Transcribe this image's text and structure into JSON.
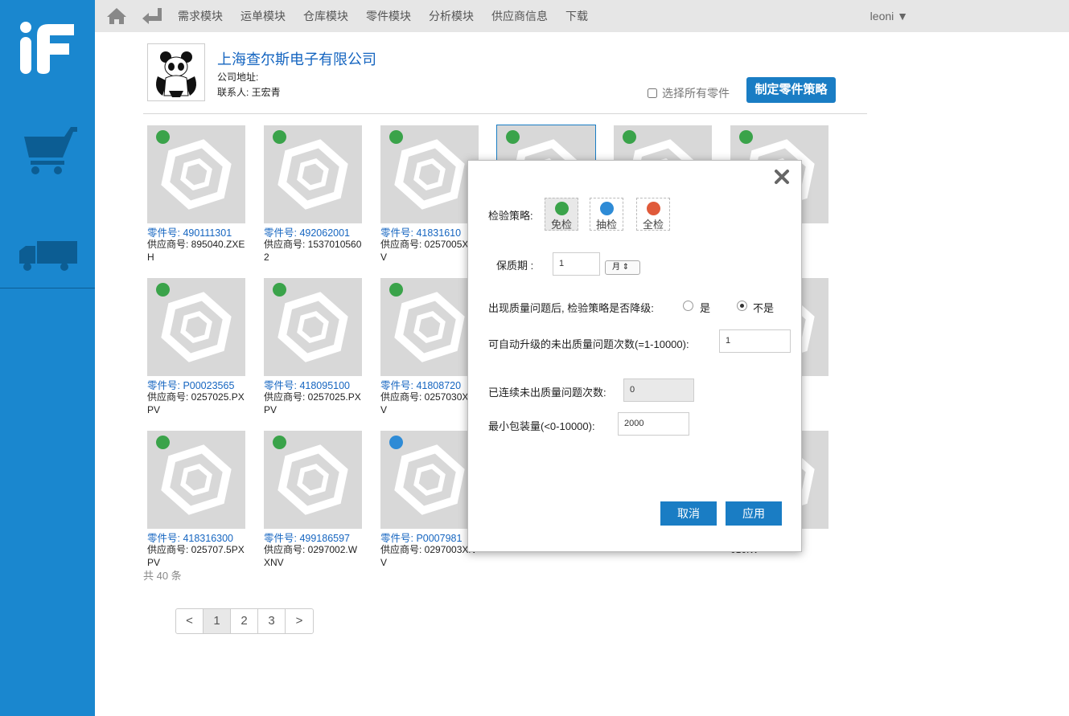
{
  "sidebar": {
    "logo_text": "iF",
    "icons": [
      "shopping-cart-icon",
      "truck-icon"
    ]
  },
  "topbar": {
    "nav": [
      "需求模块",
      "运单模块",
      "仓库模块",
      "零件模块",
      "分析模块",
      "供应商信息",
      "下载"
    ],
    "user": "leoni ▼"
  },
  "company": {
    "name": "上海查尔斯电子有限公司",
    "address_label": "公司地址:",
    "contact": "联系人:  王宏青",
    "select_all": "选择所有零件",
    "strategy_button": "制定零件策略"
  },
  "parts": [
    {
      "part": "零件号:  490111301",
      "supplier": "供应商号:  895040.ZXEH",
      "badge": "tag"
    },
    {
      "part": "零件号:  492062001",
      "supplier": "供应商号:  15370105602",
      "badge": "tag"
    },
    {
      "part": "零件号:  41831610",
      "supplier": "供应商号:  0257005XPV",
      "badge": "tag"
    },
    {
      "part": "",
      "supplier": "",
      "badge": "tag"
    },
    {
      "part": "",
      "supplier": "",
      "badge": "tag"
    },
    {
      "part": "7201",
      "supplier": "020.P",
      "badge": "tag"
    },
    {
      "part": "零件号:  P00023565",
      "supplier": "供应商号:  0257025.PXPV",
      "badge": "tag"
    },
    {
      "part": "零件号:  418095100",
      "supplier": "供应商号:  0257025.PXPV",
      "badge": "tag"
    },
    {
      "part": "零件号:  41808720",
      "supplier": "供应商号:  0257030XPV",
      "badge": "tag"
    },
    {
      "part": "",
      "supplier": "",
      "badge": ""
    },
    {
      "part": "",
      "supplier": "",
      "badge": ""
    },
    {
      "part": "7208",
      "supplier": "07.5P",
      "badge": ""
    },
    {
      "part": "零件号:  418316300",
      "supplier": "供应商号:  025707.5PXPV",
      "badge": "tag"
    },
    {
      "part": "零件号:  499186597",
      "supplier": "供应商号:  0297002.WXNV",
      "badge": "tag"
    },
    {
      "part": "零件号:  P0007981",
      "supplier": "供应商号:  0297003XNV",
      "badge": "basket"
    },
    {
      "part": "",
      "supplier": "",
      "badge": ""
    },
    {
      "part": "",
      "supplier": "",
      "badge": ""
    },
    {
      "part": "2575",
      "supplier": "010.W",
      "badge": ""
    }
  ],
  "total": "共 40 条",
  "pager": [
    "<",
    "1",
    "2",
    "3",
    ">"
  ],
  "modal": {
    "inspection_label": "检验策略:",
    "options": [
      "免检",
      "抽检",
      "全检"
    ],
    "shelf_label": "保质期 :",
    "shelf_value": "1",
    "shelf_unit": "月",
    "downgrade_label": "出现质量问题后, 检验策略是否降级:",
    "yes": "是",
    "no": "不是",
    "upgrade_label": "可自动升级的未出质量问题次数(=1-10000):",
    "upgrade_value": "1",
    "streak_label": "已连续未出质量问题次数:",
    "streak_value": "0",
    "minpack_label": "最小包装量(<0-10000):",
    "minpack_value": "2000",
    "cancel": "取消",
    "apply": "应用"
  },
  "colors": {
    "sidebar": "#1a87cf",
    "accent": "#1a7dc4",
    "tag_badge": "#3aa34a",
    "basket_badge": "#2e8bd6",
    "search_badge": "#e05a3a"
  }
}
